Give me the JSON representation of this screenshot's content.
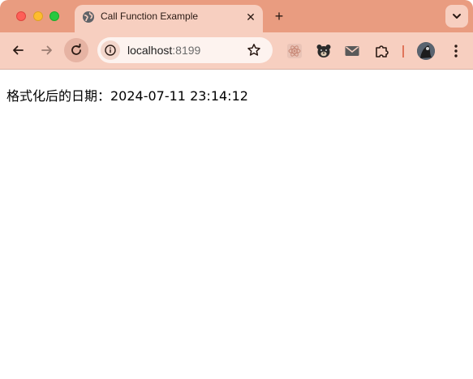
{
  "window": {
    "controls": [
      "close",
      "minimize",
      "zoom"
    ]
  },
  "tab": {
    "title": "Call Function Example",
    "favicon": "globe-icon",
    "close_label": "✕"
  },
  "new_tab_label": "+",
  "tab_search_icon": "chevron-down-icon",
  "toolbar": {
    "back_icon": "arrow-left-icon",
    "forward_icon": "arrow-right-icon",
    "reload_icon": "reload-icon",
    "site_info_icon": "info-icon",
    "bookmark_icon": "star-icon",
    "extensions": [
      "react-devtools-icon",
      "bear-icon",
      "mail-icon",
      "puzzle-icon"
    ],
    "profile_icon": "avatar",
    "menu_icon": "kebab-menu-icon"
  },
  "address_bar": {
    "host": "localhost",
    "port": ":8199"
  },
  "page": {
    "formatted_date_text": "格式化后的日期：2024-07-11 23:14:12"
  },
  "colors": {
    "tabstrip": "#e99c80",
    "toolbar": "#f7cfc0",
    "accent": "#e0755a"
  }
}
